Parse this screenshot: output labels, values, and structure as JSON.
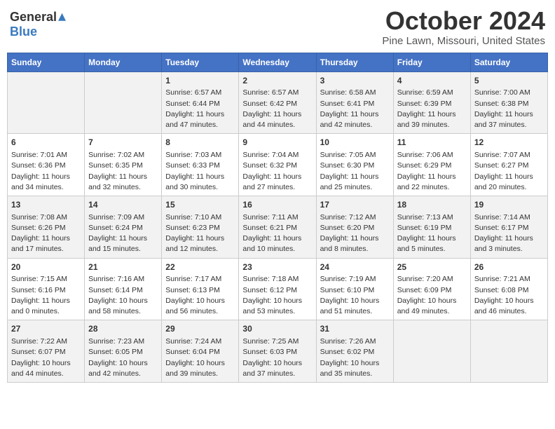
{
  "header": {
    "logo_general": "General",
    "logo_blue": "Blue",
    "month": "October 2024",
    "location": "Pine Lawn, Missouri, United States"
  },
  "weekdays": [
    "Sunday",
    "Monday",
    "Tuesday",
    "Wednesday",
    "Thursday",
    "Friday",
    "Saturday"
  ],
  "weeks": [
    [
      {
        "day": "",
        "content": ""
      },
      {
        "day": "",
        "content": ""
      },
      {
        "day": "1",
        "content": "Sunrise: 6:57 AM\nSunset: 6:44 PM\nDaylight: 11 hours and 47 minutes."
      },
      {
        "day": "2",
        "content": "Sunrise: 6:57 AM\nSunset: 6:42 PM\nDaylight: 11 hours and 44 minutes."
      },
      {
        "day": "3",
        "content": "Sunrise: 6:58 AM\nSunset: 6:41 PM\nDaylight: 11 hours and 42 minutes."
      },
      {
        "day": "4",
        "content": "Sunrise: 6:59 AM\nSunset: 6:39 PM\nDaylight: 11 hours and 39 minutes."
      },
      {
        "day": "5",
        "content": "Sunrise: 7:00 AM\nSunset: 6:38 PM\nDaylight: 11 hours and 37 minutes."
      }
    ],
    [
      {
        "day": "6",
        "content": "Sunrise: 7:01 AM\nSunset: 6:36 PM\nDaylight: 11 hours and 34 minutes."
      },
      {
        "day": "7",
        "content": "Sunrise: 7:02 AM\nSunset: 6:35 PM\nDaylight: 11 hours and 32 minutes."
      },
      {
        "day": "8",
        "content": "Sunrise: 7:03 AM\nSunset: 6:33 PM\nDaylight: 11 hours and 30 minutes."
      },
      {
        "day": "9",
        "content": "Sunrise: 7:04 AM\nSunset: 6:32 PM\nDaylight: 11 hours and 27 minutes."
      },
      {
        "day": "10",
        "content": "Sunrise: 7:05 AM\nSunset: 6:30 PM\nDaylight: 11 hours and 25 minutes."
      },
      {
        "day": "11",
        "content": "Sunrise: 7:06 AM\nSunset: 6:29 PM\nDaylight: 11 hours and 22 minutes."
      },
      {
        "day": "12",
        "content": "Sunrise: 7:07 AM\nSunset: 6:27 PM\nDaylight: 11 hours and 20 minutes."
      }
    ],
    [
      {
        "day": "13",
        "content": "Sunrise: 7:08 AM\nSunset: 6:26 PM\nDaylight: 11 hours and 17 minutes."
      },
      {
        "day": "14",
        "content": "Sunrise: 7:09 AM\nSunset: 6:24 PM\nDaylight: 11 hours and 15 minutes."
      },
      {
        "day": "15",
        "content": "Sunrise: 7:10 AM\nSunset: 6:23 PM\nDaylight: 11 hours and 12 minutes."
      },
      {
        "day": "16",
        "content": "Sunrise: 7:11 AM\nSunset: 6:21 PM\nDaylight: 11 hours and 10 minutes."
      },
      {
        "day": "17",
        "content": "Sunrise: 7:12 AM\nSunset: 6:20 PM\nDaylight: 11 hours and 8 minutes."
      },
      {
        "day": "18",
        "content": "Sunrise: 7:13 AM\nSunset: 6:19 PM\nDaylight: 11 hours and 5 minutes."
      },
      {
        "day": "19",
        "content": "Sunrise: 7:14 AM\nSunset: 6:17 PM\nDaylight: 11 hours and 3 minutes."
      }
    ],
    [
      {
        "day": "20",
        "content": "Sunrise: 7:15 AM\nSunset: 6:16 PM\nDaylight: 11 hours and 0 minutes."
      },
      {
        "day": "21",
        "content": "Sunrise: 7:16 AM\nSunset: 6:14 PM\nDaylight: 10 hours and 58 minutes."
      },
      {
        "day": "22",
        "content": "Sunrise: 7:17 AM\nSunset: 6:13 PM\nDaylight: 10 hours and 56 minutes."
      },
      {
        "day": "23",
        "content": "Sunrise: 7:18 AM\nSunset: 6:12 PM\nDaylight: 10 hours and 53 minutes."
      },
      {
        "day": "24",
        "content": "Sunrise: 7:19 AM\nSunset: 6:10 PM\nDaylight: 10 hours and 51 minutes."
      },
      {
        "day": "25",
        "content": "Sunrise: 7:20 AM\nSunset: 6:09 PM\nDaylight: 10 hours and 49 minutes."
      },
      {
        "day": "26",
        "content": "Sunrise: 7:21 AM\nSunset: 6:08 PM\nDaylight: 10 hours and 46 minutes."
      }
    ],
    [
      {
        "day": "27",
        "content": "Sunrise: 7:22 AM\nSunset: 6:07 PM\nDaylight: 10 hours and 44 minutes."
      },
      {
        "day": "28",
        "content": "Sunrise: 7:23 AM\nSunset: 6:05 PM\nDaylight: 10 hours and 42 minutes."
      },
      {
        "day": "29",
        "content": "Sunrise: 7:24 AM\nSunset: 6:04 PM\nDaylight: 10 hours and 39 minutes."
      },
      {
        "day": "30",
        "content": "Sunrise: 7:25 AM\nSunset: 6:03 PM\nDaylight: 10 hours and 37 minutes."
      },
      {
        "day": "31",
        "content": "Sunrise: 7:26 AM\nSunset: 6:02 PM\nDaylight: 10 hours and 35 minutes."
      },
      {
        "day": "",
        "content": ""
      },
      {
        "day": "",
        "content": ""
      }
    ]
  ]
}
